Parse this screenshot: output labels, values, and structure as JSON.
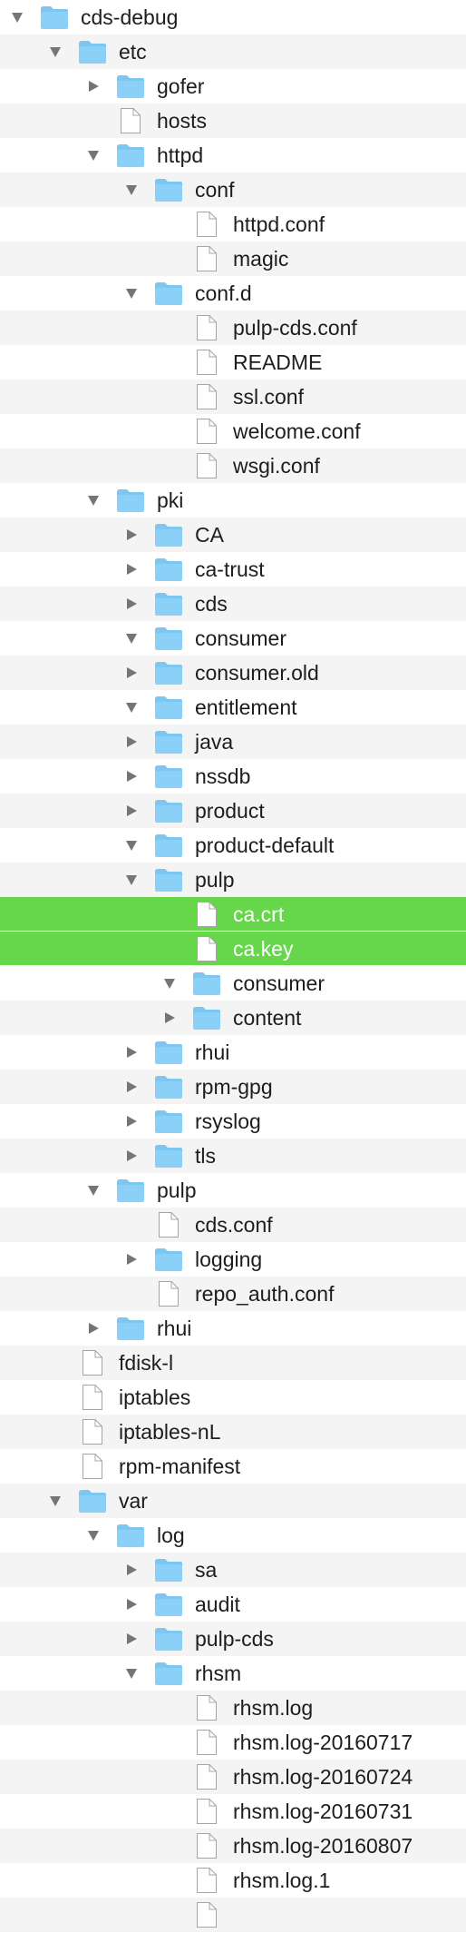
{
  "tree": [
    {
      "label": "cds-debug",
      "kind": "folder",
      "depth": 0,
      "expanded": true
    },
    {
      "label": "etc",
      "kind": "folder",
      "depth": 1,
      "expanded": true
    },
    {
      "label": "gofer",
      "kind": "folder",
      "depth": 2,
      "expanded": false
    },
    {
      "label": "hosts",
      "kind": "file",
      "depth": 2
    },
    {
      "label": "httpd",
      "kind": "folder",
      "depth": 2,
      "expanded": true
    },
    {
      "label": "conf",
      "kind": "folder",
      "depth": 3,
      "expanded": true
    },
    {
      "label": "httpd.conf",
      "kind": "file",
      "depth": 4
    },
    {
      "label": "magic",
      "kind": "file",
      "depth": 4
    },
    {
      "label": "conf.d",
      "kind": "folder",
      "depth": 3,
      "expanded": true
    },
    {
      "label": "pulp-cds.conf",
      "kind": "file",
      "depth": 4
    },
    {
      "label": "README",
      "kind": "file",
      "depth": 4
    },
    {
      "label": "ssl.conf",
      "kind": "file",
      "depth": 4
    },
    {
      "label": "welcome.conf",
      "kind": "file",
      "depth": 4
    },
    {
      "label": "wsgi.conf",
      "kind": "file",
      "depth": 4
    },
    {
      "label": "pki",
      "kind": "folder",
      "depth": 2,
      "expanded": true
    },
    {
      "label": "CA",
      "kind": "folder",
      "depth": 3,
      "expanded": false
    },
    {
      "label": "ca-trust",
      "kind": "folder",
      "depth": 3,
      "expanded": false
    },
    {
      "label": "cds",
      "kind": "folder",
      "depth": 3,
      "expanded": false
    },
    {
      "label": "consumer",
      "kind": "folder",
      "depth": 3,
      "expanded": true
    },
    {
      "label": "consumer.old",
      "kind": "folder",
      "depth": 3,
      "expanded": false
    },
    {
      "label": "entitlement",
      "kind": "folder",
      "depth": 3,
      "expanded": true
    },
    {
      "label": "java",
      "kind": "folder",
      "depth": 3,
      "expanded": false
    },
    {
      "label": "nssdb",
      "kind": "folder",
      "depth": 3,
      "expanded": false
    },
    {
      "label": "product",
      "kind": "folder",
      "depth": 3,
      "expanded": false
    },
    {
      "label": "product-default",
      "kind": "folder",
      "depth": 3,
      "expanded": true
    },
    {
      "label": "pulp",
      "kind": "folder",
      "depth": 3,
      "expanded": true
    },
    {
      "label": "ca.crt",
      "kind": "file",
      "depth": 4,
      "selected": true
    },
    {
      "label": "ca.key",
      "kind": "file",
      "depth": 4,
      "selected": true
    },
    {
      "label": "consumer",
      "kind": "folder",
      "depth": 4,
      "expanded": true
    },
    {
      "label": "content",
      "kind": "folder",
      "depth": 4,
      "expanded": false
    },
    {
      "label": "rhui",
      "kind": "folder",
      "depth": 3,
      "expanded": false
    },
    {
      "label": "rpm-gpg",
      "kind": "folder",
      "depth": 3,
      "expanded": false
    },
    {
      "label": "rsyslog",
      "kind": "folder",
      "depth": 3,
      "expanded": false
    },
    {
      "label": "tls",
      "kind": "folder",
      "depth": 3,
      "expanded": false
    },
    {
      "label": "pulp",
      "kind": "folder",
      "depth": 2,
      "expanded": true
    },
    {
      "label": "cds.conf",
      "kind": "file",
      "depth": 3
    },
    {
      "label": "logging",
      "kind": "folder",
      "depth": 3,
      "expanded": false
    },
    {
      "label": "repo_auth.conf",
      "kind": "file",
      "depth": 3
    },
    {
      "label": "rhui",
      "kind": "folder",
      "depth": 2,
      "expanded": false
    },
    {
      "label": "fdisk-l",
      "kind": "file",
      "depth": 1
    },
    {
      "label": "iptables",
      "kind": "file",
      "depth": 1
    },
    {
      "label": "iptables-nL",
      "kind": "file",
      "depth": 1
    },
    {
      "label": "rpm-manifest",
      "kind": "file",
      "depth": 1
    },
    {
      "label": "var",
      "kind": "folder",
      "depth": 1,
      "expanded": true
    },
    {
      "label": "log",
      "kind": "folder",
      "depth": 2,
      "expanded": true
    },
    {
      "label": "sa",
      "kind": "folder",
      "depth": 3,
      "expanded": false
    },
    {
      "label": "audit",
      "kind": "folder",
      "depth": 3,
      "expanded": false
    },
    {
      "label": "pulp-cds",
      "kind": "folder",
      "depth": 3,
      "expanded": false
    },
    {
      "label": "rhsm",
      "kind": "folder",
      "depth": 3,
      "expanded": true
    },
    {
      "label": "rhsm.log",
      "kind": "file",
      "depth": 4
    },
    {
      "label": "rhsm.log-20160717",
      "kind": "file",
      "depth": 4
    },
    {
      "label": "rhsm.log-20160724",
      "kind": "file",
      "depth": 4
    },
    {
      "label": "rhsm.log-20160731",
      "kind": "file",
      "depth": 4
    },
    {
      "label": "rhsm.log-20160807",
      "kind": "file",
      "depth": 4
    },
    {
      "label": "rhsm.log.1",
      "kind": "file",
      "depth": 4
    },
    {
      "label": "",
      "kind": "file",
      "depth": 4
    }
  ],
  "colors": {
    "selection": "#66d64a",
    "folder": "#8ad0f7",
    "folder_tab": "#7cc6f2",
    "arrow": "#757575",
    "text": "#1d1d1d",
    "alt_row": "#f4f4f4"
  },
  "icons": {
    "folder": "folder-icon",
    "file": "document-icon",
    "expanded": "disclosure-triangle-down-icon",
    "collapsed": "disclosure-triangle-right-icon"
  }
}
